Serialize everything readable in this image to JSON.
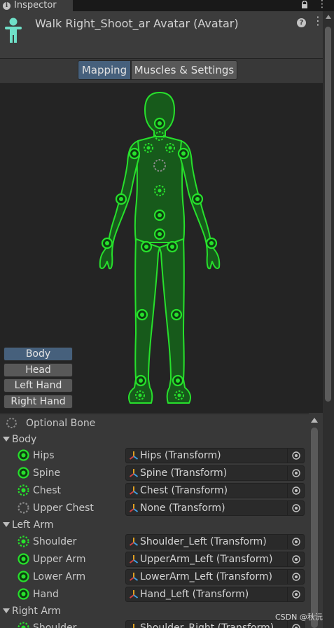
{
  "tab": {
    "label": "Inspector"
  },
  "header": {
    "title": "Walk Right_Shoot_ar Avatar (Avatar)",
    "help_glyph": "?"
  },
  "modes": [
    {
      "label": "Mapping",
      "active": true
    },
    {
      "label": "Muscles & Settings",
      "active": false
    }
  ],
  "body_parts": [
    {
      "label": "Body",
      "selected": true
    },
    {
      "label": "Head",
      "selected": false
    },
    {
      "label": "Left Hand",
      "selected": false
    },
    {
      "label": "Right Hand",
      "selected": false
    }
  ],
  "legend": {
    "optional_bone": "Optional Bone"
  },
  "groups": [
    {
      "label": "Body",
      "bones": [
        {
          "label": "Hips",
          "value": "Hips (Transform)",
          "optional": false
        },
        {
          "label": "Spine",
          "value": "Spine (Transform)",
          "optional": false
        },
        {
          "label": "Chest",
          "value": "Chest (Transform)",
          "optional": true
        },
        {
          "label": "Upper Chest",
          "value": "None (Transform)",
          "optional": true,
          "empty": true
        }
      ]
    },
    {
      "label": "Left Arm",
      "bones": [
        {
          "label": "Shoulder",
          "value": "Shoulder_Left (Transform)",
          "optional": true
        },
        {
          "label": "Upper Arm",
          "value": "UpperArm_Left (Transform)",
          "optional": false
        },
        {
          "label": "Lower Arm",
          "value": "LowerArm_Left (Transform)",
          "optional": false
        },
        {
          "label": "Hand",
          "value": "Hand_Left (Transform)",
          "optional": false
        }
      ]
    },
    {
      "label": "Right Arm",
      "bones": [
        {
          "label": "Shoulder",
          "value": "Shoulder_Right (Transform)",
          "optional": true
        }
      ]
    }
  ],
  "watermark": "CSDN @秋沅",
  "colors": {
    "accent_green": "#22d22a",
    "selected_blue": "#46607c",
    "avatar_icon": "#6fe0c8"
  }
}
